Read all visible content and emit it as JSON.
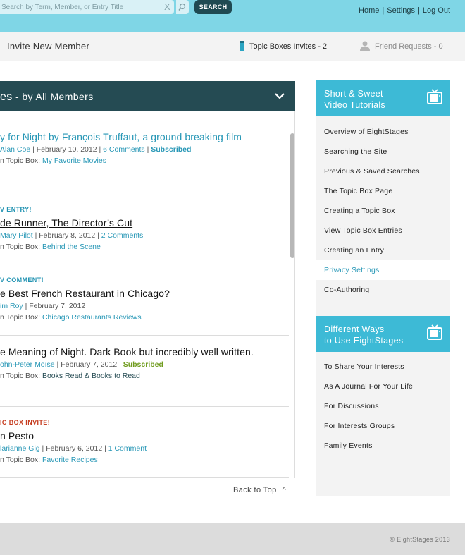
{
  "header": {
    "search_placeholder": "Search by Term, Member, or Entry Title",
    "clear_glyph": "X",
    "search_button": "SEARCH",
    "links": [
      "Home",
      "Settings",
      "Log Out"
    ],
    "link_separator": "|"
  },
  "subbar": {
    "invite": "Invite New Member",
    "topic_invites": "Topic Boxes Invites - 2",
    "friend_requests": "Friend Requests - 0"
  },
  "panel": {
    "title_prefix": "es",
    "title_suffix": " - by All Members",
    "entries": [
      {
        "tag": "",
        "title": "y for Night by François Truffaut, a ground breaking film",
        "author": "Alan Coe",
        "date": "February 10, 2012",
        "comments": "6 Comments",
        "status": "Subscribed",
        "box_prefix": "n Topic Box:",
        "box": "My Favorite Movies"
      },
      {
        "tag": "V ENTRY!",
        "title": "de Runner, The Director’s Cut",
        "author": "Mary Pilot",
        "date": "February 8, 2012",
        "comments": "2 Comments",
        "status": "",
        "box_prefix": "n Topic Box:",
        "box": "Behind the Scene"
      },
      {
        "tag": "V COMMENT!",
        "title": "e Best French Restaurant in Chicago?",
        "author": "im Roy",
        "date": "February 7, 2012",
        "comments": "",
        "status": "",
        "box_prefix": "n Topic Box:",
        "box": "Chicago Restaurants Reviews"
      },
      {
        "tag": "",
        "title": "e Meaning of Night. Dark Book but incredibly well written.",
        "author": "ohn-Peter Moïse",
        "date": "February 7, 2012",
        "comments": "",
        "status": "Subscribed",
        "box_prefix": "n Topic Box:",
        "box": "Books Read & Books to Read"
      },
      {
        "tag": "IC BOX INVITE!",
        "title": "n Pesto",
        "author": "larianne Gig",
        "date": "February 6, 2012",
        "comments": "1 Comment",
        "status": "",
        "box_prefix": "n Topic Box:",
        "box": "Favorite Recipes"
      }
    ],
    "back_to_top": "Back to Top",
    "up_glyph": "^"
  },
  "sidebar": {
    "tutorials_title_line1": "Short & Sweet",
    "tutorials_title_line2": "Video Tutorials",
    "tutorials": [
      "Overview of EightStages",
      "Searching the Site",
      "Previous & Saved Searches",
      "The Topic Box Page",
      "Creating a Topic Box",
      "View Topic Box Entries",
      "Creating an Entry",
      "Privacy Settings",
      "Co-Authoring"
    ],
    "active_tutorial": "Privacy Settings",
    "ways_title_line1": "Different Ways",
    "ways_title_line2": "to Use EightStages",
    "ways": [
      "To Share Your Interests",
      "As A Journal For Your Life",
      "For Discussions",
      "For Interests Groups",
      "Family Events"
    ]
  },
  "footer": {
    "copyright": "© EightStages 2013"
  },
  "colors": {
    "topbar": "#7fd6e6",
    "panel_header": "#254b53",
    "sidebar_header": "#3dbad6",
    "link": "#2797b6",
    "alert_red": "#c53a1d",
    "subscribed_green": "#6f9b1d"
  }
}
